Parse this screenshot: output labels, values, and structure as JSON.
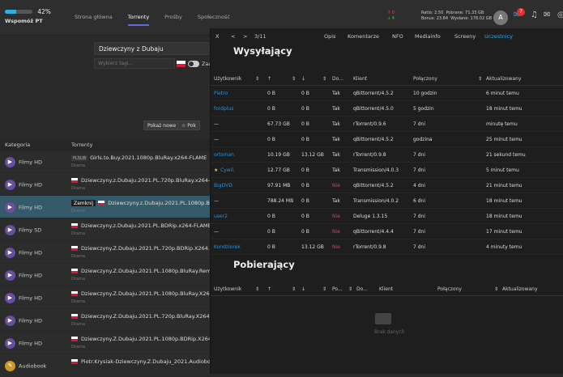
{
  "topbar": {
    "support_pct": "42%",
    "support_fill": 0.42,
    "support_label": "Wspomóż PT",
    "nav": [
      "Strona główna",
      "Torrenty",
      "Prośby",
      "Społeczność"
    ],
    "stats": {
      "up": "↑ 0",
      "down": "↓ 4",
      "ratio": "Ratio: 2.50",
      "bonus": "Bonus: 23.84",
      "pobrane": "Pobrane: 71.33 GB",
      "wysylane": "Wysłane: 178.02 GB"
    },
    "avatar": "A",
    "notif_count": "7"
  },
  "search": {
    "value": "Dziewczyny z Dubaju",
    "tags_placeholder": "Wybierz tagi...",
    "toggle_label": "Zaa"
  },
  "buttons": {
    "show_new": "Pokaż nowe",
    "pok": "Pok"
  },
  "list": {
    "headers": [
      "Kategoria",
      "Torrenty"
    ],
    "rows": [
      {
        "cat": "Filmy HD",
        "tag": "PLSUB",
        "title": "Girls.to.Buy.2021.1080p.BluRay.x264-FLAME",
        "sub": "Drama"
      },
      {
        "cat": "Filmy HD",
        "tag": "",
        "title": "Dziewczyny.z.Dubaju.2021.PL.720p.BluRay.x264-FLAME",
        "sub": "Drama"
      },
      {
        "cat": "Filmy HD",
        "tag": "Zamknij",
        "title": "Dziewczyny.z.Dubaju.2021.PL.1080p.BluRay",
        "sub": "Drama"
      },
      {
        "cat": "Filmy SD",
        "tag": "",
        "title": "Dziewczyny.z.Dubaju.2021.PL.BDRip.x264-FLAME",
        "sub": "Drama"
      },
      {
        "cat": "Filmy HD",
        "tag": "",
        "title": "Dziewczyny.Z.Dubaju.2021.PL.720p.BDRip.X264.AC3",
        "sub": "Drama"
      },
      {
        "cat": "Filmy HD",
        "tag": "",
        "title": "Dziewczyny.Z.Dubaju.2021.PL.1080p.BluRay.Remux",
        "sub": "Drama"
      },
      {
        "cat": "Filmy HD",
        "tag": "",
        "title": "Dziewczyny.Z.Dubaju.2021.PL.1080p.BluRay.X264.DD",
        "sub": "Drama"
      },
      {
        "cat": "Filmy HD",
        "tag": "",
        "title": "Dziewczyny.Z.Dubaju.2021.PL.720p.BluRay.X264.DD",
        "sub": "Drama"
      },
      {
        "cat": "Filmy HD",
        "tag": "",
        "title": "Dziewczyny.Z.Dubaju.2021.PL.1080p.BDRip.X264.AC",
        "sub": "Drama"
      },
      {
        "cat": "Audiobook",
        "tag": "",
        "title": "Piotr.Krysiak-Dziewczyny.Z.Dubaju_2021.Audiobook",
        "sub": ""
      }
    ]
  },
  "panel": {
    "close": "X",
    "prev": "<",
    "next": ">",
    "counter": "3/11",
    "tabs": [
      "Opis",
      "Komentarze",
      "NFO",
      "Mediainfo",
      "Screeny",
      "Uczestnicy"
    ],
    "seeding_title": "Wysyłający",
    "leeching_title": "Pobierający",
    "headers": [
      "Użytkownik",
      "↑",
      "↓",
      "Do...",
      "Klient",
      "Połączony",
      "Aktualizowany"
    ],
    "leech_headers": [
      "Użytkownik",
      "↑",
      "↓",
      "Po...",
      "Do...",
      "Klient",
      "Połączony",
      "Aktualizowany"
    ],
    "seeders": [
      {
        "user": "Pietro",
        "up": "0 B",
        "down": "0 B",
        "do": "Tak",
        "client": "qBittorrent/4.5.2",
        "conn": "10 godzin",
        "upd": "6 minut temu"
      },
      {
        "user": "fordplus",
        "up": "0 B",
        "down": "0 B",
        "do": "Tak",
        "client": "qBittorrent/4.5.0",
        "conn": "5 godzin",
        "upd": "18 minut temu"
      },
      {
        "user": "—",
        "up": "67.73 GB",
        "down": "0 B",
        "do": "Tak",
        "client": "rTorrent/0.9.6",
        "conn": "7 dni",
        "upd": "minutę temu"
      },
      {
        "user": "—",
        "up": "0 B",
        "down": "0 B",
        "do": "Tak",
        "client": "qBittorrent/4.5.2",
        "conn": "godzina",
        "upd": "25 minut temu"
      },
      {
        "user": "ortsman",
        "up": "10.19 GB",
        "down": "13.12 GB",
        "do": "Tak",
        "client": "rTorrent/0.9.8",
        "conn": "7 dni",
        "upd": "21 sekund temu"
      },
      {
        "user": "Cywil.",
        "up": "12.77 GB",
        "down": "0 B",
        "do": "Tak",
        "client": "Transmission/4.0.3",
        "conn": "7 dni",
        "upd": "5 minut temu"
      },
      {
        "user": "BigDVD",
        "up": "97.91 MB",
        "down": "0 B",
        "do": "Nie",
        "client": "qBittorrent/4.5.2",
        "conn": "4 dni",
        "upd": "21 minut temu"
      },
      {
        "user": "—",
        "up": "788.24 MB",
        "down": "0 B",
        "do": "Tak",
        "client": "Transmission/4.0.2",
        "conn": "6 dni",
        "upd": "18 minut temu"
      },
      {
        "user": "user2",
        "up": "0 B",
        "down": "0 B",
        "do": "Nie",
        "client": "Deluge 1.3.15",
        "conn": "7 dni",
        "upd": "18 minut temu"
      },
      {
        "user": "—",
        "up": "0 B",
        "down": "0 B",
        "do": "Nie",
        "client": "qBittorrent/4.4.4",
        "conn": "7 dni",
        "upd": "17 minut temu"
      },
      {
        "user": "Kondziorek",
        "up": "0 B",
        "down": "13.12 GB",
        "do": "Nie",
        "client": "rTorrent/0.9.8",
        "conn": "7 dni",
        "upd": "4 minuty temu"
      }
    ],
    "empty": "Brak danych"
  }
}
